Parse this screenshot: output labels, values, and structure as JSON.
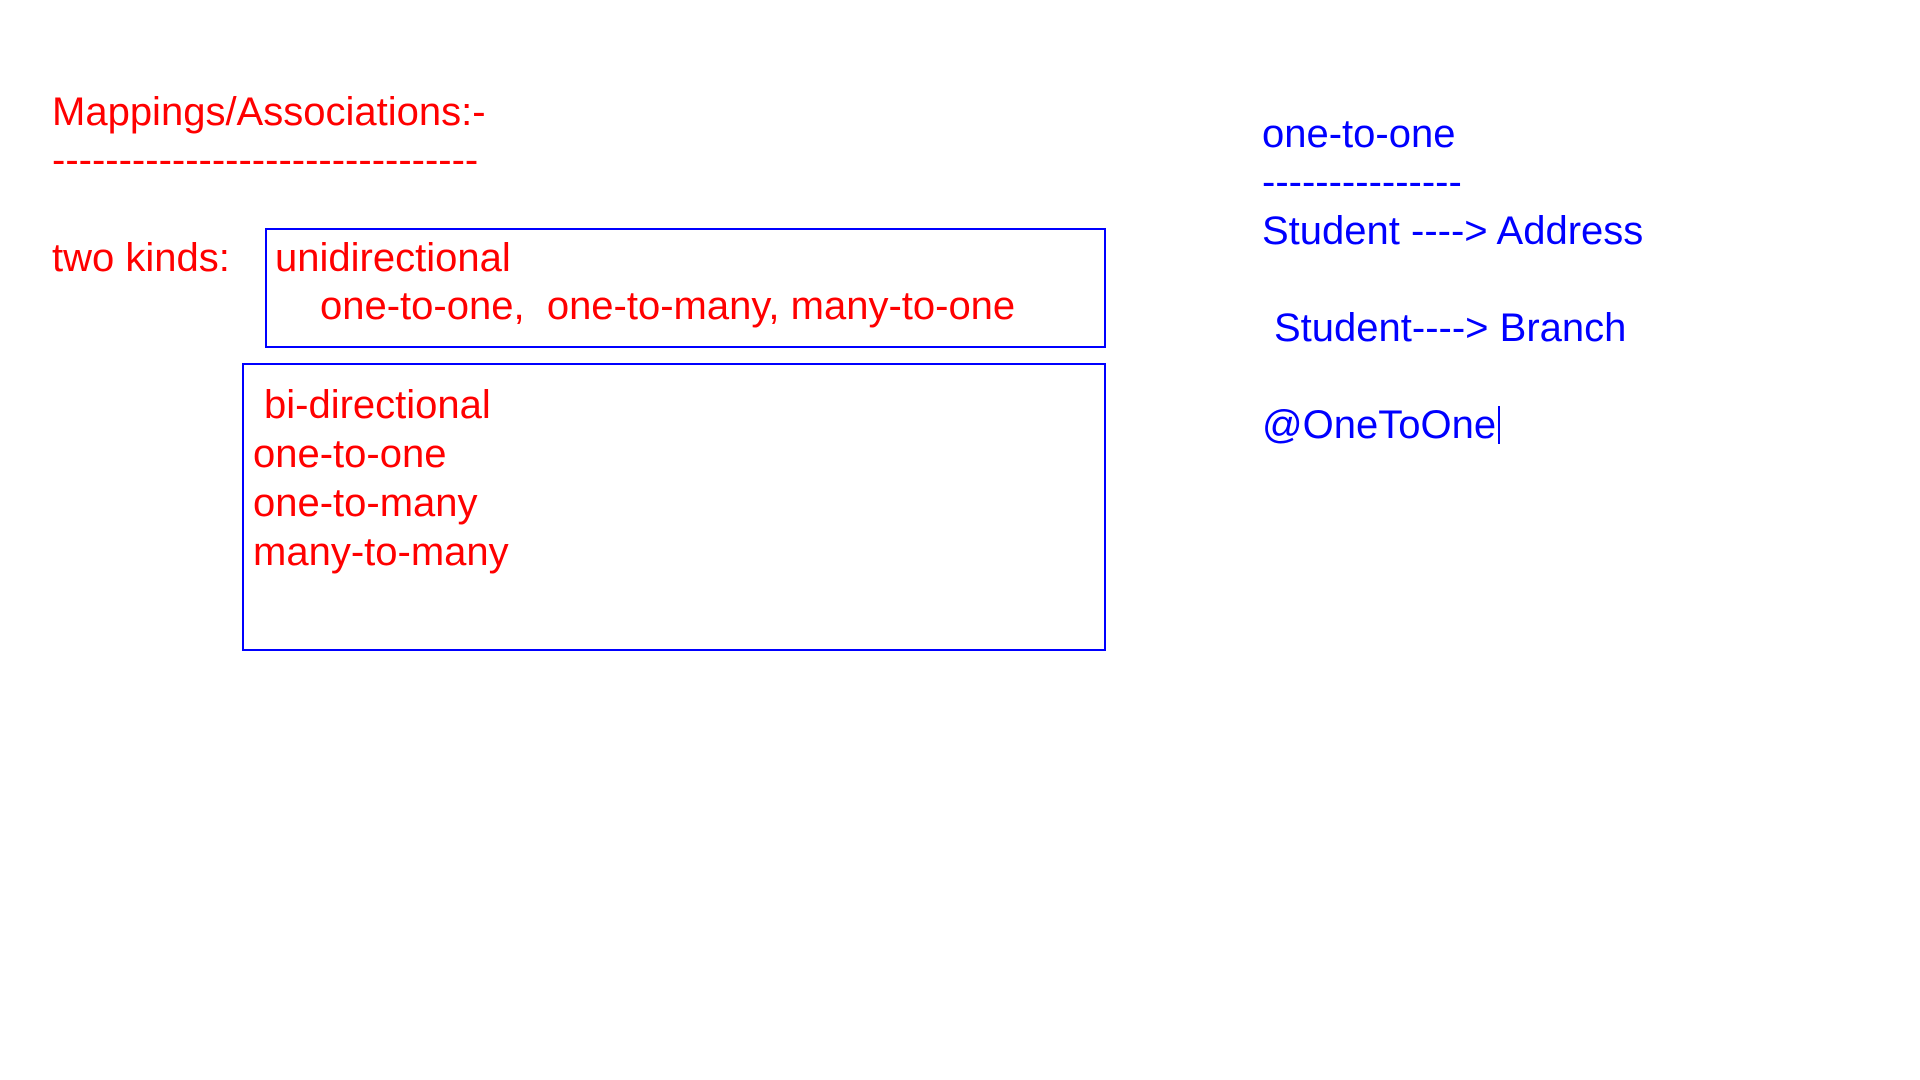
{
  "colors": {
    "left_text": "#ff0000",
    "right_text": "#0000ff",
    "box_border": "#0000ff",
    "background": "#ffffff"
  },
  "left": {
    "title": "Mappings/Associations:-",
    "title_underline": "--------------------------------",
    "kinds_label": "two kinds:",
    "unidirectional": {
      "heading": "unidirectional",
      "items": "one-to-one,  one-to-many, many-to-one"
    },
    "bidirectional": {
      "heading": "bi-directional",
      "items": [
        "one-to-one",
        "one-to-many",
        "many-to-many"
      ]
    }
  },
  "right": {
    "heading": "one-to-one",
    "heading_underline": "---------------",
    "line1": "Student ----> Address",
    "line2": "Student----> Branch",
    "annotation": "@OneToOne"
  }
}
